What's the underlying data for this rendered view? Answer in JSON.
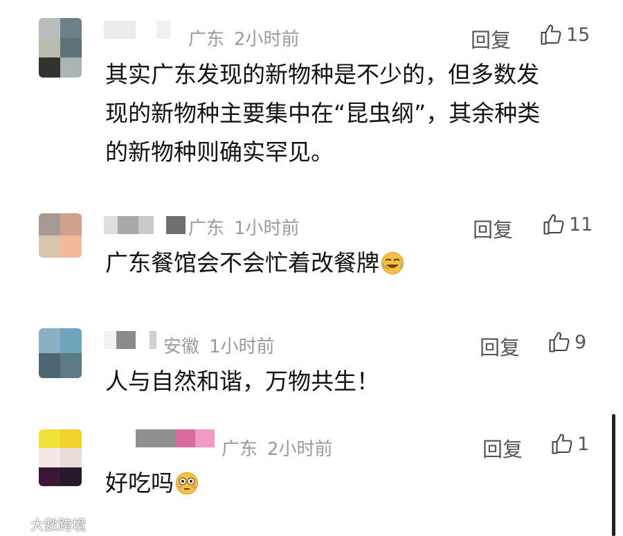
{
  "comments": [
    {
      "location": "广东",
      "time": "2小时前",
      "reply_label": "回复",
      "likes": "15",
      "lines": [
        "其实广东发现的新物种是不少的，但多数发",
        "现的新物种主要集中在“昆虫纲”，其余种类",
        "的新物种则确实罕见。"
      ]
    },
    {
      "location": "广东",
      "time": "1小时前",
      "reply_label": "回复",
      "likes": "11",
      "text": "广东餐馆会不会忙着改餐牌",
      "emoji": "laughing-crying-emoji"
    },
    {
      "location": "安徽",
      "time": "1小时前",
      "reply_label": "回复",
      "likes": "9",
      "text": "人与自然和谐，万物共生！"
    },
    {
      "location": "广东",
      "time": "2小时前",
      "reply_label": "回复",
      "likes": "1",
      "text": "好吃吗",
      "emoji": "flushed-face-emoji"
    }
  ],
  "watermark": "大數跨境",
  "icons": {
    "like": "thumbs-up-icon"
  },
  "colors": {
    "meta": "#9a9a9a",
    "text": "#111111",
    "action": "#555555"
  }
}
